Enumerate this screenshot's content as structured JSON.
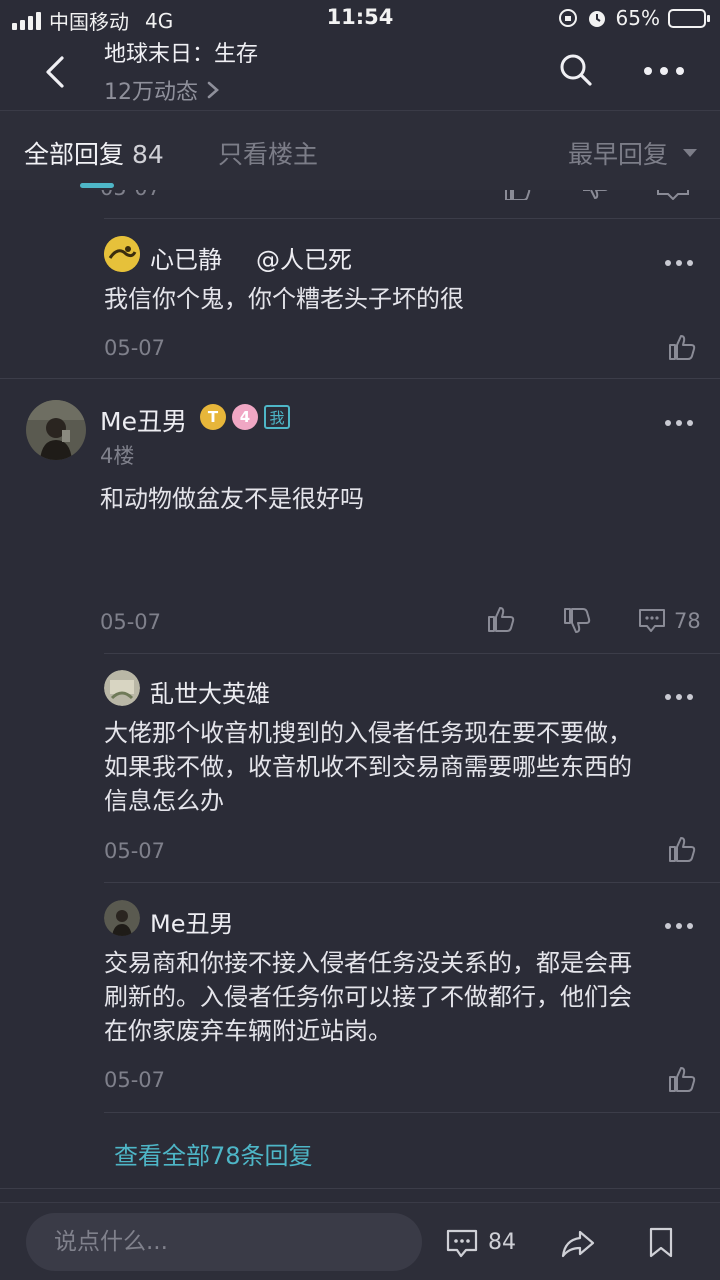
{
  "status_bar": {
    "carrier": "中国移动",
    "network": "4G",
    "time": "11:54",
    "battery": "65%",
    "battery_level": 0.65
  },
  "header": {
    "title": "地球末日：生存",
    "subtitle": "12万动态"
  },
  "tabs": {
    "all_label": "全部回复",
    "all_count": "84",
    "owner_label": "只看楼主",
    "sort_label": "最早回复"
  },
  "thread_top": {
    "prev_date": "05-07",
    "reply1": {
      "author": "心已静",
      "mention": "@人已死",
      "text": "我信你个鬼，你个糟老头子坏的很",
      "date": "05-07"
    }
  },
  "floor": {
    "author": "Me丑男",
    "level": "4",
    "me_badge": "我",
    "floor_label": "4楼",
    "text": "和动物做盆友不是很好吗",
    "date": "05-07",
    "reply_count": "78",
    "replies": [
      {
        "author": "乱世大英雄",
        "lines": [
          "大佬那个收音机搜到的入侵者任务现在要不要做，",
          "如果我不做，收音机收不到交易商需要哪些东西的",
          "信息怎么办"
        ],
        "date": "05-07"
      },
      {
        "author": "Me丑男",
        "lines": [
          "交易商和你接不接入侵者任务没关系的，都是会再",
          "刷新的。入侵者任务你可以接了不做都行，他们会",
          "在你家废弃车辆附近站岗。"
        ],
        "date": "05-07"
      }
    ],
    "view_all": "查看全部78条回复"
  },
  "bottom_bar": {
    "placeholder": "说点什么...",
    "comment_count": "84"
  },
  "colors": {
    "background": "#2b2c37",
    "accent": "#4eb6c7",
    "muted": "#7f808b"
  }
}
